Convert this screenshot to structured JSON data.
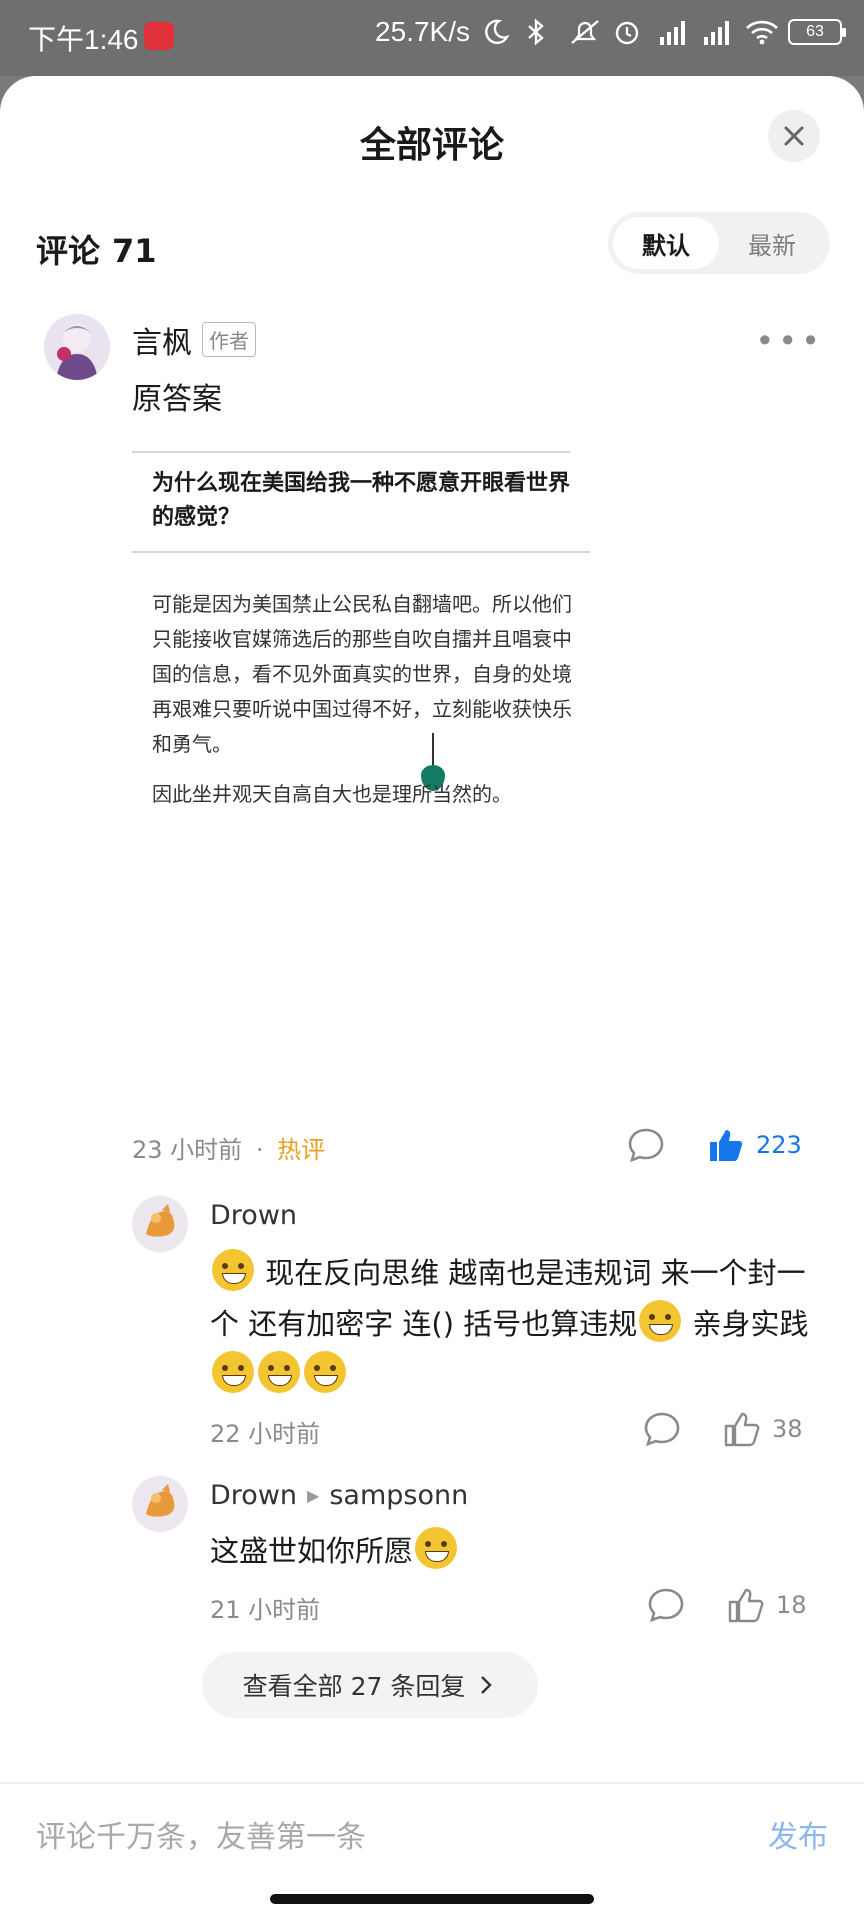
{
  "status_bar": {
    "time": "下午1:46",
    "net_speed": "25.7K/s",
    "battery": "63"
  },
  "sheet": {
    "title": "全部评论",
    "comment_label": "评论",
    "comment_count": "71",
    "sort": {
      "default": "默认",
      "latest": "最新"
    }
  },
  "main_comment": {
    "author": "言枫",
    "author_tag": "作者",
    "text": "原答案",
    "embed": {
      "question": "为什么现在美国给我一种不愿意开眼看世界的感觉？",
      "answer_p1": "可能是因为美国禁止公民私自翻墙吧。所以他们只能接收官媒筛选后的那些自吹自擂并且唱衰中国的信息，看不见外面真实的世界，自身的处境再艰难只要听说中国过得不好，立刻能收获快乐和勇气。",
      "answer_p2": "因此坐井观天自高自大也是理所当然的。"
    },
    "time": "23 小时前",
    "separator": "·",
    "hot_label": "热评",
    "likes": "223"
  },
  "replies": [
    {
      "author": "Drown",
      "text_parts": [
        "现在反向思维 越南也是违规词 来一个封一个 还有加密字 连() 括号也算违规",
        "亲身实践"
      ],
      "time": "22 小时前",
      "likes": "38"
    },
    {
      "author": "Drown",
      "reply_to": "sampsonn",
      "text": "这盛世如你所愿",
      "time": "21 小时前",
      "likes": "18"
    }
  ],
  "view_all": "查看全部 27 条回复",
  "input": {
    "placeholder": "评论千万条，友善第一条",
    "publish": "发布"
  },
  "colors": {
    "accent_blue": "#1677e8",
    "hot_orange": "#e8a11f",
    "publish_disabled": "#8cb6ee"
  }
}
